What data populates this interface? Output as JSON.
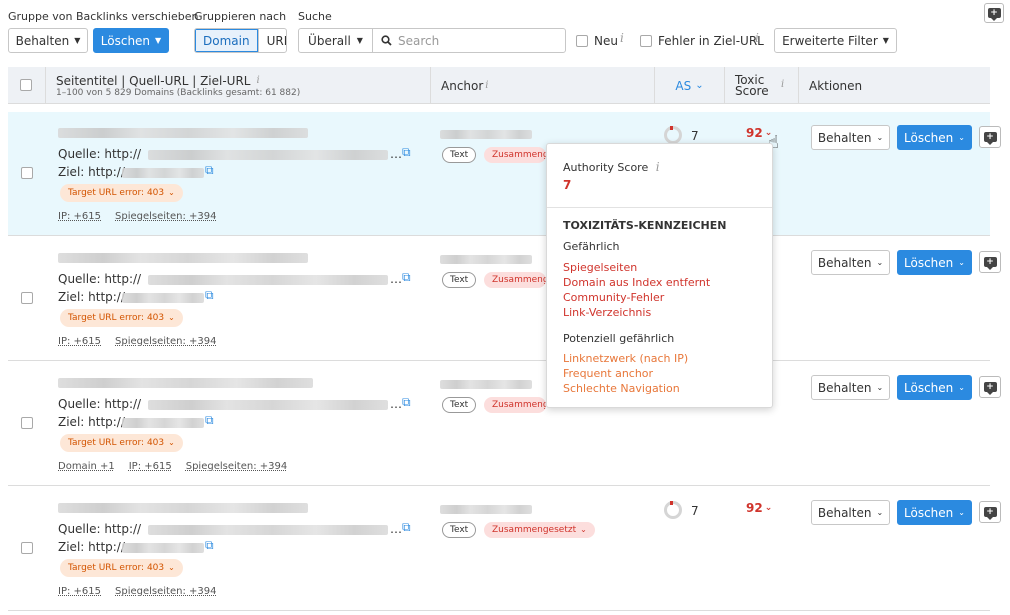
{
  "toolbar": {
    "move_label": "Gruppe von Backlinks verschieben",
    "group_label": "Gruppieren nach",
    "search_label": "Suche",
    "keep_btn": "Behalten",
    "delete_btn": "Löschen",
    "group_domain": "Domain",
    "group_url": "URL",
    "scope": "Überall",
    "search_placeholder": "Search",
    "new_label": "Neu",
    "error_label": "Fehler in Ziel-URL",
    "filter_btn": "Erweiterte Filter"
  },
  "table": {
    "col_title": "Seitentitel | Quell-URL | Ziel-URL",
    "col_subtitle": "1–100 von 5 829 Domains (Backlinks gesamt: 61 882)",
    "col_anchor": "Anchor",
    "col_as": "AS",
    "col_toxic_1": "Toxic",
    "col_toxic_2": "Score",
    "col_actions": "Aktionen"
  },
  "rows": [
    {
      "source": "Quelle: http://",
      "ellipsis": "…",
      "target": "Ziel: http://",
      "error": "Target URL error: 403",
      "meta": [
        "IP: +615",
        "Spiegelseiten: +394"
      ],
      "tag_text": "Text",
      "tag_comp": "Zusammengesetzt",
      "as": "7",
      "toxic": "92",
      "keep": "Behalten",
      "delete": "Löschen"
    },
    {
      "source": "Quelle: http://",
      "ellipsis": "…",
      "target": "Ziel: http://",
      "error": "Target URL error: 403",
      "meta": [
        "IP: +615",
        "Spiegelseiten: +394"
      ],
      "tag_text": "Text",
      "tag_comp": "Zusammengesetzt",
      "keep": "Behalten",
      "delete": "Löschen"
    },
    {
      "source": "Quelle: http://",
      "ellipsis": "…",
      "target": "Ziel: http://",
      "error": "Target URL error: 403",
      "meta": [
        "Domain +1",
        "IP: +615",
        "Spiegelseiten: +394"
      ],
      "tag_text": "Text",
      "tag_comp": "Zusammengesetzt",
      "keep": "Behalten",
      "delete": "Löschen"
    },
    {
      "source": "Quelle: http://",
      "ellipsis": "…",
      "target": "Ziel: http://",
      "error": "Target URL error: 403",
      "meta": [
        "IP: +615",
        "Spiegelseiten: +394"
      ],
      "tag_text": "Text",
      "tag_comp": "Zusammengesetzt",
      "as": "7",
      "toxic": "92",
      "keep": "Behalten",
      "delete": "Löschen"
    }
  ],
  "popup": {
    "authority_label": "Authority Score",
    "authority_value": "7",
    "heading": "TOXIZITÄTS-KENNZEICHEN",
    "dangerous_label": "Gefährlich",
    "dangerous_items": [
      "Spiegelseiten",
      "Domain aus Index entfernt",
      "Community-Fehler",
      "Link-Verzeichnis"
    ],
    "potential_label": "Potenziell gefährlich",
    "potential_items": [
      "Linknetzwerk (nach IP)",
      "Frequent anchor",
      "Schlechte Navigation"
    ]
  },
  "colors": {
    "primary": "#2b8ae0",
    "danger": "#d0342c",
    "warning": "#e8773a",
    "highlight_row": "#e9f8fd"
  }
}
